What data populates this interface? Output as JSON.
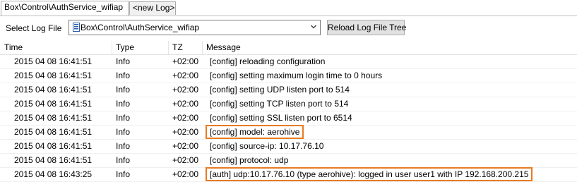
{
  "tabs": [
    {
      "label": "Box\\Control\\AuthService_wifiap",
      "active": true
    },
    {
      "label": "<new Log>",
      "active": false
    }
  ],
  "toolbar": {
    "select_label": "Select Log File",
    "combo_value": "Box\\Control\\AuthService_wifiap",
    "reload_label": "Reload Log File Tree"
  },
  "table": {
    "columns": [
      "Time",
      "Type",
      "TZ",
      "Message"
    ],
    "rows": [
      {
        "time": "2015 04 08 16:41:51",
        "type": "Info",
        "tz": "+02:00",
        "message": "[config] reloading configuration",
        "highlighted": false
      },
      {
        "time": "2015 04 08 16:41:51",
        "type": "Info",
        "tz": "+02:00",
        "message": "[config] setting maximum login time to 0 hours",
        "highlighted": false
      },
      {
        "time": "2015 04 08 16:41:51",
        "type": "Info",
        "tz": "+02:00",
        "message": "[config] setting UDP listen port to 514",
        "highlighted": false
      },
      {
        "time": "2015 04 08 16:41:51",
        "type": "Info",
        "tz": "+02:00",
        "message": "[config] setting TCP listen port to 514",
        "highlighted": false
      },
      {
        "time": "2015 04 08 16:41:51",
        "type": "Info",
        "tz": "+02:00",
        "message": "[config] setting SSL listen port to 6514",
        "highlighted": false
      },
      {
        "time": "2015 04 08 16:41:51",
        "type": "Info",
        "tz": "+02:00",
        "message": "[config] model: aerohive",
        "highlighted": true
      },
      {
        "time": "2015 04 08 16:41:51",
        "type": "Info",
        "tz": "+02:00",
        "message": "[config] source-ip: 10.17.76.10",
        "highlighted": false
      },
      {
        "time": "2015 04 08 16:41:51",
        "type": "Info",
        "tz": "+02:00",
        "message": "[config] protocol: udp",
        "highlighted": false
      },
      {
        "time": "2015 04 08 16:43:25",
        "type": "Info",
        "tz": "+02:00",
        "message": "[auth] udp:10.17.76.10 (type aerohive): logged in user user1 with IP 192.168.200.215",
        "highlighted": true
      }
    ]
  },
  "colors": {
    "highlight": "#e87b22",
    "file_icon": "#2a5caa"
  },
  "icons": {
    "combo_file": "file-icon",
    "combo_arrow": "chevron-down-icon"
  }
}
